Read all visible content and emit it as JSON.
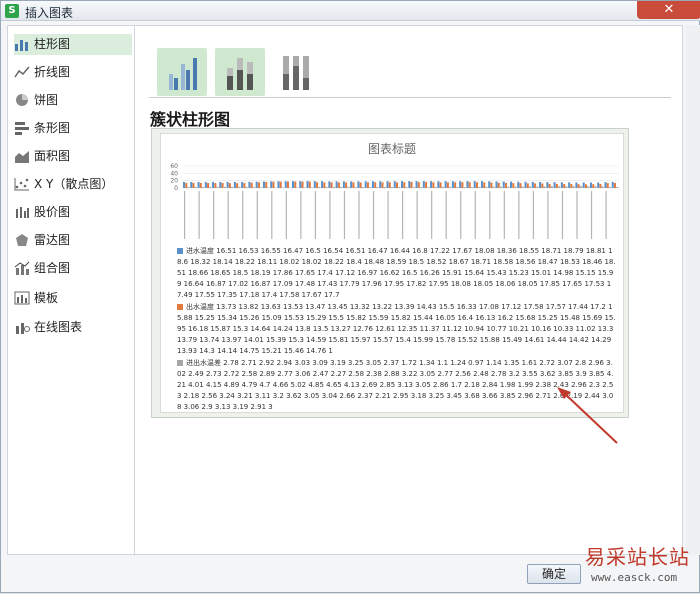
{
  "window": {
    "title": "插入图表",
    "app_icon": "S",
    "close_label": "✕"
  },
  "sidebar": {
    "items": [
      {
        "label": "柱形图",
        "icon": "bar-chart-icon",
        "active": true
      },
      {
        "label": "折线图",
        "icon": "line-chart-icon"
      },
      {
        "label": "饼图",
        "icon": "pie-chart-icon"
      },
      {
        "label": "条形图",
        "icon": "horizontal-bar-icon"
      },
      {
        "label": "面积图",
        "icon": "area-chart-icon"
      },
      {
        "label": "X Y（散点图）",
        "icon": "scatter-chart-icon"
      },
      {
        "label": "股价图",
        "icon": "stock-chart-icon"
      },
      {
        "label": "雷达图",
        "icon": "radar-chart-icon"
      },
      {
        "label": "组合图",
        "icon": "combo-chart-icon"
      },
      {
        "label": "模板",
        "icon": "template-icon"
      },
      {
        "label": "在线图表",
        "icon": "online-chart-icon"
      }
    ]
  },
  "subtypes": [
    {
      "name": "clustered-column",
      "selected": true
    },
    {
      "name": "stacked-column",
      "selected": true
    },
    {
      "name": "percent-stacked-column",
      "selected": false
    }
  ],
  "chart_type_title": "簇状柱形图",
  "preview": {
    "chart_title": "图表标题",
    "axis_ticks": [
      "60",
      "40",
      "20",
      "0"
    ]
  },
  "legend": {
    "s1": {
      "name": "进水温度",
      "color": "#5b8fc7",
      "text": "16.51 16.53 16.55 16.47 16.5 16.54 16.51 16.47 16.44 16.8 17.22 17.67 18.08 18.36 18.55 18.71 18.79 18.81 18.6 18.32 18.14 18.22 18.11 18.02 18.02 18.22 18.4 18.48 18.59 18.5 18.52 18.67 18.71 18.58 18.56 18.47 18.53 18.46 18.51 18.66 18.65 18.5 18.19 17.86 17.65 17.4 17.12 16.97 16.62 16.5 16.26 15.91 15.64 15.43 15.23 15.01 14.98 15.15 15.99 16.64 16.87 17.02 16.87 17.09 17.48 17.43 17.79 17.96 17.95 17.82 17.95 18.08 18.05 18.06 18.05 17.85 17.65 17.53 17.49 17.55 17.35 17.18 17.4 17.58 17.67 17.7"
    },
    "s2": {
      "name": "出水温度",
      "color": "#e07a3f",
      "text": "13.73 13.82 13.63 13.53 13.47 13.45 13.32 13.22 13.39 14.43 15.5 16.33 17.08 17.12 17.58 17.57 17.44 17.2 15.88 15.25 15.34 15.26 15.09 15.53 15.29 15.5 15.82 15.59 15.82 15.44 16.05 16.4 16.13 16.2 15.68 15.25 15.48 15.69 15.95 16.18 15.87 15.3 14.64 14.24 13.8 13.5 13.27 12.76 12.61 12.35 11.37 11.12 10.94 10.77 10.21 10.16 10.33 11.02 13.3 13.79 13.74 13.97 14.01 15.39 15.3 14.59 15.81 15.97 15.57 15.4 15.99 15.78 15.52 15.88 15.49 14.61 14.44 14.42 14.29 13.93 14.3 14.14 14.75 15.21 15.46 14.76 1"
    },
    "s3": {
      "name": "进出水温差",
      "color": "#a5a5a5",
      "text": "2.78 2.71 2.92 2.94 3.03 3.09 3.19 3.25 3.05 2.37 1.72 1.34 1.1 1.24 0.97 1.14 1.35 1.61 2.72 3.07 2.8 2.96 3.02 2.49 2.73 2.72 2.58 2.89 2.77 3.06 2.47 2.27 2.58 2.38 2.88 3.22 3.05 2.77 2.56 2.48 2.78 3.2 3.55 3.62 3.85 3.9 3.85 4.21 4.01 4.15 4.89 4.79 4.7 4.66 5.02 4.85 4.65 4.13 2.69 2.85 3.13 3.05 2.86 1.7 2.18 2.84 1.98 1.99 2.38 2.43 2.96 2.3 2.53 2.18 2.56 3.24 3.21 3.11 3.2 3.62 3.05 3.04 2.66 2.37 2.21 2.95 3.18 3.25 3.45 3.68 3.66 3.85 2.96 2.71 2.6 2.19 2.44 3.08 3.06 2.9 3.13 3.19 2.91 3"
    }
  },
  "buttons": {
    "ok": "确定"
  },
  "watermark": {
    "text": "易采站长站",
    "url": "www.easck.com"
  },
  "colors": {
    "active_bg": "#dbeedd",
    "accent_green": "#2fa34a",
    "bar_blue": "#5b8fc7",
    "bar_orange": "#e07a3f",
    "bar_gray": "#a5a5a5"
  }
}
